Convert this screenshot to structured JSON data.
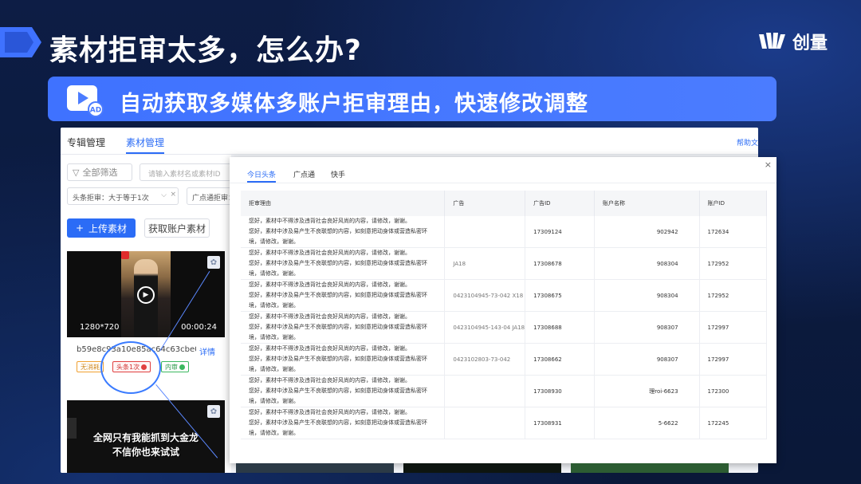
{
  "title": "素材拒审太多，怎么办?",
  "logo": {
    "text": "创量",
    "icon": "chuangliang-logo-icon"
  },
  "banner": {
    "text": "自动获取多媒体多账户拒审理由，快速修改调整",
    "icon": "video-ad-icon"
  },
  "app": {
    "top_tabs": [
      "专辑管理",
      "素材管理"
    ],
    "active_top_tab": "素材管理",
    "help_link": "帮助文",
    "filter_label": "全部筛选",
    "search_placeholder": "请输入素材名或素材ID",
    "select_a": "头条拒审：大于等于1次",
    "select_b": "广点通拒审：",
    "upload_label": "上传素材",
    "fetch_label": "获取账户素材",
    "card1": {
      "resolution": "1280*720",
      "duration": "00:00:24",
      "name": "b59e8c93a10e85ac64c63cbe044b...",
      "detail": "详情",
      "tags": [
        "无消耗",
        "头条1次",
        "内审"
      ]
    },
    "card2": {
      "line1": "全网只有我能抓到大金龙",
      "line2": "不信你也来试试"
    }
  },
  "modal": {
    "tabs": [
      "今日头条",
      "广点通",
      "快手"
    ],
    "active_tab": "今日头条",
    "columns": [
      "拒审理由",
      "广告",
      "广告ID",
      "账户名称",
      "账户ID"
    ],
    "rows": [
      {
        "reason": [
          "您好，素材中不得涉及违背社会良好风尚的内容，请修改，谢谢。",
          "您好，素材中涉及易产生不良联想的内容，如刻意把动身体或营造私密环",
          "境，请修改，谢谢。"
        ],
        "ad": "",
        "ad_id": "17309124",
        "account": "902942",
        "account_id": "172634"
      },
      {
        "reason": [
          "您好，素材中不得涉及违背社会良好风尚的内容，请修改，谢谢。",
          "您好，素材中涉及易产生不良联想的内容，如刻意把动身体或营造私密环",
          "境，请修改，谢谢。"
        ],
        "ad": "JA18",
        "ad_id": "17308678",
        "account": "908304",
        "account_id": "172952"
      },
      {
        "reason": [
          "您好，素材中不得涉及违背社会良好风尚的内容，请修改，谢谢。",
          "您好，素材中涉及易产生不良联想的内容，如刻意把动身体或营造私密环",
          "境，请修改，谢谢。"
        ],
        "ad": "0423104945-73-042 X18",
        "ad_id": "17308675",
        "account": "908304",
        "account_id": "172952"
      },
      {
        "reason": [
          "您好，素材中不得涉及违背社会良好风尚的内容，请修改，谢谢。",
          "您好，素材中涉及易产生不良联想的内容，如刻意把动身体或营造私密环",
          "境，请修改，谢谢。"
        ],
        "ad": "0423104945-143-04 JA18",
        "ad_id": "17308688",
        "account": "908307",
        "account_id": "172997"
      },
      {
        "reason": [
          "您好，素材中不得涉及违背社会良好风尚的内容，请修改，谢谢。",
          "您好，素材中涉及易产生不良联想的内容，如刻意把动身体或营造私密环",
          "境，请修改，谢谢。"
        ],
        "ad": "0423102803-73-042",
        "ad_id": "17308662",
        "account": "908307",
        "account_id": "172997"
      },
      {
        "reason": [
          "您好，素材中不得涉及违背社会良好风尚的内容，请修改，谢谢。",
          "您好，素材中涉及易产生不良联想的内容，如刻意把动身体或营造私密环",
          "境，请修改，谢谢。"
        ],
        "ad": "",
        "ad_id": "17308930",
        "account": "理roi-6623",
        "account_id": "172300"
      },
      {
        "reason": [
          "您好，素材中不得涉及违背社会良好风尚的内容，请修改，谢谢。",
          "您好，素材中涉及易产生不良联想的内容，如刻意把动身体或营造私密环",
          "境，请修改，谢谢。"
        ],
        "ad": "",
        "ad_id": "17308931",
        "account": "5-6622",
        "account_id": "172245"
      }
    ]
  },
  "colors": {
    "accent": "#2b6cf6",
    "banner": "#4b7cff",
    "background": "#0b1a3c"
  }
}
